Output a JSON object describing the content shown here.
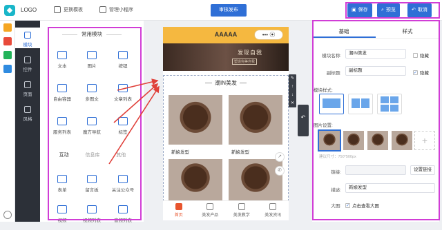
{
  "header": {
    "logo": "LOGO",
    "change_template": "更换模板",
    "manage_program": "管理小程序",
    "publish": "审核发布",
    "save": "保存",
    "preview": "预览",
    "cancel": "取消"
  },
  "nav": [
    {
      "label": "模块",
      "icon": "plus-icon",
      "active": true
    },
    {
      "label": "控件",
      "icon": "grid-icon"
    },
    {
      "label": "页面",
      "icon": "page-icon"
    },
    {
      "label": "风格",
      "icon": "palette-icon"
    }
  ],
  "modules": {
    "title": "常用模块",
    "items": [
      {
        "label": "文本",
        "icon": "text-icon"
      },
      {
        "label": "图片",
        "icon": "image-icon"
      },
      {
        "label": "按钮",
        "icon": "button-icon"
      },
      {
        "label": "自由容器",
        "icon": "container-icon"
      },
      {
        "label": "多图文",
        "icon": "multi-article-icon"
      },
      {
        "label": "文章列表",
        "icon": "article-list-icon"
      },
      {
        "label": "服务列表",
        "icon": "service-list-icon"
      },
      {
        "label": "魔方导航",
        "icon": "cube-nav-icon"
      },
      {
        "label": "标签",
        "icon": "tag-icon"
      }
    ],
    "tabs": [
      "互动",
      "信息库",
      "其他"
    ],
    "interactive": [
      {
        "label": "表单",
        "icon": "form-icon"
      },
      {
        "label": "留言板",
        "icon": "message-board-icon"
      },
      {
        "label": "关注公众号",
        "icon": "follow-icon"
      },
      {
        "label": "视频",
        "icon": "video-icon"
      },
      {
        "label": "视频列表",
        "icon": "video-list-icon"
      },
      {
        "label": "音频列表",
        "icon": "audio-list-icon"
      }
    ]
  },
  "phone": {
    "title": "AAAAA",
    "capsule": "•••  ⦿",
    "banner_title": "发现自我",
    "banner_sub": "塑造完美自我",
    "section_title": "潮IN美发",
    "cards": [
      "新娘发型",
      "新娘发型"
    ],
    "tabbar": [
      {
        "label": "首页",
        "active": true
      },
      {
        "label": "美发产品"
      },
      {
        "label": "美发教学"
      },
      {
        "label": "美发资讯"
      }
    ]
  },
  "settings": {
    "tabs": [
      "基础",
      "样式"
    ],
    "module_name_label": "模块名称:",
    "module_name": "潮IN美发",
    "hide_label": "隐藏",
    "subtitle_label": "副标题:",
    "subtitle": "副标题",
    "subtitle_hide_label": "隐藏",
    "subtitle_hide_checked": true,
    "style_label": "模块样式:",
    "image_settings_label": "图片设置:",
    "suggest_size": "建议尺寸：750*500px",
    "link_label": "链接:",
    "set_link": "设置链接",
    "desc_label": "描述:",
    "desc": "新娘发型",
    "bigimg_label": "大图:",
    "bigimg_option": "点击查看大图",
    "bigimg_checked": true
  }
}
